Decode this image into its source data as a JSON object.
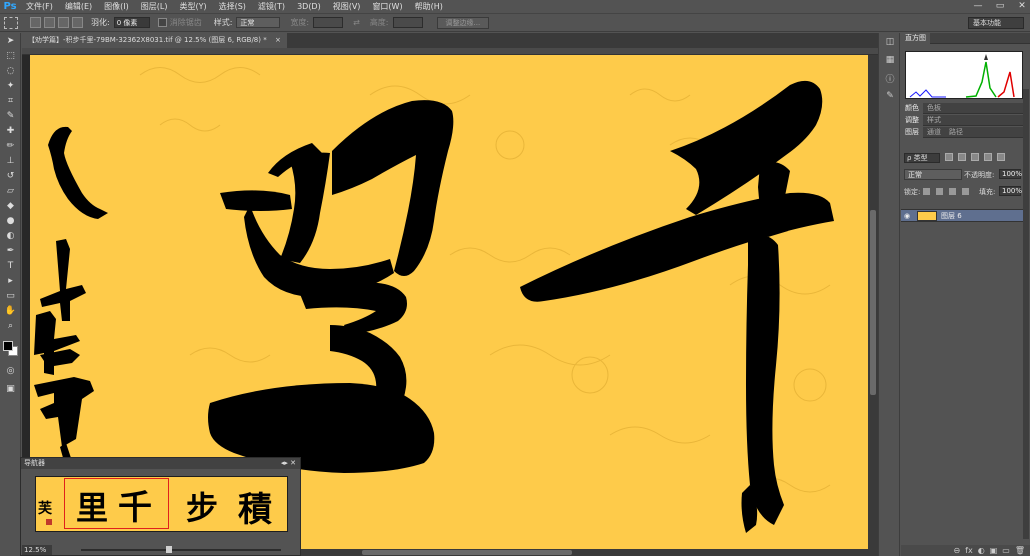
{
  "app": {
    "logo": "Ps"
  },
  "menu": [
    "文件(F)",
    "编辑(E)",
    "图像(I)",
    "图层(L)",
    "类型(Y)",
    "选择(S)",
    "滤镜(T)",
    "3D(D)",
    "视图(V)",
    "窗口(W)",
    "帮助(H)"
  ],
  "window_controls": [
    "—",
    "▭",
    "✕"
  ],
  "options": {
    "feather_label": "羽化:",
    "feather_value": "0 像素",
    "antialias_label": "消除锯齿",
    "style_label": "样式:",
    "style_value": "正常",
    "width_label": "宽度:",
    "height_label": "高度:",
    "refine_button": "调整边缘...",
    "workspace": "基本功能"
  },
  "document": {
    "tab_title": "【劝学篇】-积步千里-79BM-32362X8031.tif @ 12.5% (图层 6, RGB/8) *",
    "tab_close": "×"
  },
  "canvas": {
    "background_color": "#fecb4a",
    "ink_color": "#000000"
  },
  "navigator": {
    "title": "导航器",
    "zoom": "12.5%",
    "preview_chars": [
      "千",
      "里",
      "步",
      "積"
    ]
  },
  "panels": {
    "top_tab": "直方图",
    "color_tabs": [
      "颜色",
      "色板"
    ],
    "adjust_tabs": [
      "调整",
      "样式"
    ],
    "layer_tabs": [
      "图层",
      "通道",
      "路径"
    ],
    "filter_kind": "ρ 类型",
    "blend_mode": "正常",
    "opacity_label": "不透明度:",
    "opacity_value": "100%",
    "lock_label": "锁定:",
    "fill_label": "填充:",
    "fill_value": "100%",
    "layer_name": "图层 6",
    "layer_selected_color": "#5f6f8f",
    "bottom_icons": [
      "⊖",
      "fx",
      "◐",
      "▣",
      "▭",
      "🗑"
    ]
  }
}
